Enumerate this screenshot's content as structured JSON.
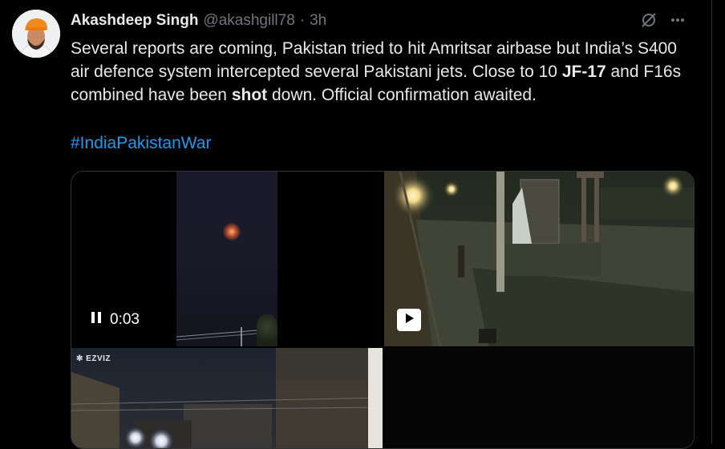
{
  "author": {
    "name": "Akashdeep Singh",
    "handle": "@akashgill78",
    "separator": "·",
    "time": "3h"
  },
  "tweet": {
    "t1": "Several reports are coming, Pakistan tried to hit Amritsar airbase but India’s S400 air defence system intercepted several Pakistani jets. Close to 10 ",
    "b1": "JF-17",
    "t2": " and F16s combined have been ",
    "b2": "shot",
    "t3": " down. Official confirmation awaited.",
    "hashtag": "#IndiaPakistanWar"
  },
  "media": {
    "video1_time": "0:03",
    "video3_watermark": "EZVIZ"
  },
  "icons": {
    "grok": "grok-icon",
    "more": "more-icon",
    "pause": "pause-icon",
    "play": "play-icon"
  },
  "colors": {
    "background": "#000000",
    "text": "#e7e9ea",
    "muted": "#71767b",
    "link": "#1d9bf0"
  }
}
